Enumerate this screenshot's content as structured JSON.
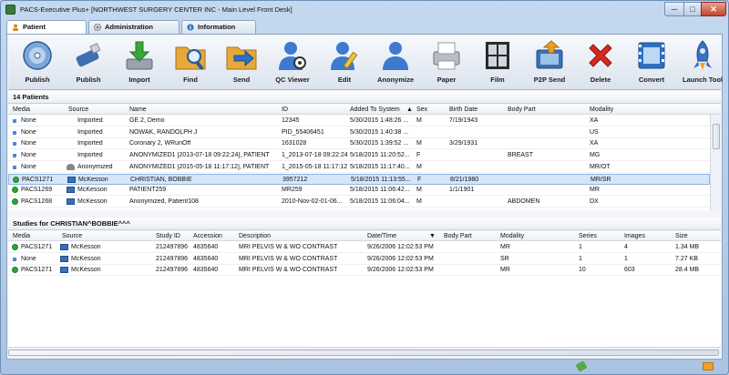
{
  "window": {
    "title": "PACS-Executive Plus+ [NORTHWEST SURGERY CENTER INC - Main Level Front Desk]",
    "minimize": "─",
    "maximize": "□",
    "close": "✕"
  },
  "tabs": [
    {
      "label": "Patient",
      "active": true
    },
    {
      "label": "Administration",
      "active": false
    },
    {
      "label": "Information",
      "active": false
    }
  ],
  "toolbar": [
    {
      "label": "Publish",
      "icon": "disc-publish-icon"
    },
    {
      "label": "Publish",
      "icon": "usb-publish-icon"
    },
    {
      "label": "Import",
      "icon": "import-icon"
    },
    {
      "label": "Find",
      "icon": "find-folder-icon"
    },
    {
      "label": "Send",
      "icon": "send-folder-icon"
    },
    {
      "label": "QC Viewer",
      "icon": "qc-viewer-icon"
    },
    {
      "label": "Edit",
      "icon": "edit-user-icon"
    },
    {
      "label": "Anonymize",
      "icon": "anonymize-user-icon"
    },
    {
      "label": "Paper",
      "icon": "paper-printer-icon"
    },
    {
      "label": "Film",
      "icon": "film-icon"
    },
    {
      "label": "P2P Send",
      "icon": "p2p-send-icon"
    },
    {
      "label": "Delete",
      "icon": "delete-x-icon"
    },
    {
      "label": "Convert",
      "icon": "convert-film-icon"
    },
    {
      "label": "Launch Tool",
      "icon": "rocket-icon"
    }
  ],
  "patients": {
    "heading": "14 Patients",
    "columns": [
      "Media",
      "Source",
      "Name",
      "ID",
      "Added To System",
      "Sex",
      "Birth Date",
      "Body Part",
      "Modality"
    ],
    "sort_arrow": "▲",
    "rows": [
      {
        "media": "None",
        "media_status": "none",
        "source": "Imported",
        "source_type": "imported",
        "name": "GE 2, Demo",
        "id": "12345",
        "added": "5/30/2015 1:48:26 ...",
        "sex": "M",
        "birth": "7/19/1943",
        "body": "",
        "modality": "XA",
        "selected": false
      },
      {
        "media": "None",
        "media_status": "none",
        "source": "Imported",
        "source_type": "imported",
        "name": "NOWAK, RANDOLPH J",
        "id": "PID_55406451",
        "added": "5/30/2015 1:40:38 ...",
        "sex": "",
        "birth": "",
        "body": "",
        "modality": "US",
        "selected": false
      },
      {
        "media": "None",
        "media_status": "none",
        "source": "Imported",
        "source_type": "imported",
        "name": "Coronary 2, WRunOff",
        "id": "1631028",
        "added": "5/30/2015 1:39:52 ...",
        "sex": "M",
        "birth": "3/29/1931",
        "body": "",
        "modality": "XA",
        "selected": false
      },
      {
        "media": "None",
        "media_status": "none",
        "source": "Imported",
        "source_type": "imported",
        "name": "ANONYMIZED1 [2013-07-18 09:22:24], PATIENT",
        "id": "1_2013-07-18 09:22:24",
        "added": "5/18/2015 11:20:52...",
        "sex": "F",
        "birth": "",
        "body": "BREAST",
        "modality": "MG",
        "selected": false
      },
      {
        "media": "None",
        "media_status": "none",
        "source": "Anonymized",
        "source_type": "anon",
        "name": "ANONYMIZED1 [2015-05-18 11:17:12], PATIENT",
        "id": "1_2015-05-18 11:17:12",
        "added": "5/18/2015 11:17:40...",
        "sex": "M",
        "birth": "",
        "body": "",
        "modality": "MR/OT",
        "selected": false
      },
      {
        "media": "PACS1271",
        "media_status": "ok",
        "source": "McKesson",
        "source_type": "mck",
        "name": "CHRISTIAN, BOBBIE",
        "id": "3957212",
        "added": "5/18/2015 11:13:55...",
        "sex": "F",
        "birth": "8/21/1980",
        "body": "",
        "modality": "MR/SR",
        "selected": true
      },
      {
        "media": "PACS1269",
        "media_status": "ok",
        "source": "McKesson",
        "source_type": "mck",
        "name": "PATIENT259",
        "id": "MR259",
        "added": "5/18/2015 11:06:42...",
        "sex": "M",
        "birth": "1/1/1901",
        "body": "",
        "modality": "MR",
        "selected": false
      },
      {
        "media": "PACS1268",
        "media_status": "ok",
        "source": "McKesson",
        "source_type": "mck",
        "name": "Anonymized, Patient108",
        "id": "2010-Nov-02-01-06...",
        "added": "5/18/2015 11:06:04...",
        "sex": "M",
        "birth": "",
        "body": "ABDOMEN",
        "modality": "DX",
        "selected": false
      }
    ]
  },
  "studies": {
    "heading": "Studies for CHRISTIAN^BOBBIE^^^",
    "columns": [
      "Media",
      "Source",
      "Study ID",
      "Accession",
      "Description",
      "Date/Time",
      "Body Part",
      "Modality",
      "Series",
      "Images",
      "Size"
    ],
    "sort_arrow": "▼",
    "rows": [
      {
        "media": "PACS1271",
        "media_status": "ok",
        "source": "McKesson",
        "study_id": "212497896",
        "accession": "4835640",
        "description": "MRI PELVIS W & WO CONTRAST",
        "datetime": "9/26/2006 12:02:53 PM",
        "body": "",
        "modality": "MR",
        "series": "1",
        "images": "4",
        "size": "1.34 MB"
      },
      {
        "media": "None",
        "media_status": "none",
        "source": "McKesson",
        "study_id": "212497896",
        "accession": "4835640",
        "description": "MRI PELVIS W & WO CONTRAST",
        "datetime": "9/26/2006 12:02:53 PM",
        "body": "",
        "modality": "SR",
        "series": "1",
        "images": "1",
        "size": "7.27 KB"
      },
      {
        "media": "PACS1271",
        "media_status": "ok",
        "source": "McKesson",
        "study_id": "212497896",
        "accession": "4835640",
        "description": "MRI PELVIS W & WO CONTRAST",
        "datetime": "9/26/2006 12:02:53 PM",
        "body": "",
        "modality": "MR",
        "series": "10",
        "images": "603",
        "size": "28.4 MB"
      }
    ]
  },
  "status": {
    "left_icon": "connection-status-icon",
    "right_icon": "folder-status-icon"
  }
}
